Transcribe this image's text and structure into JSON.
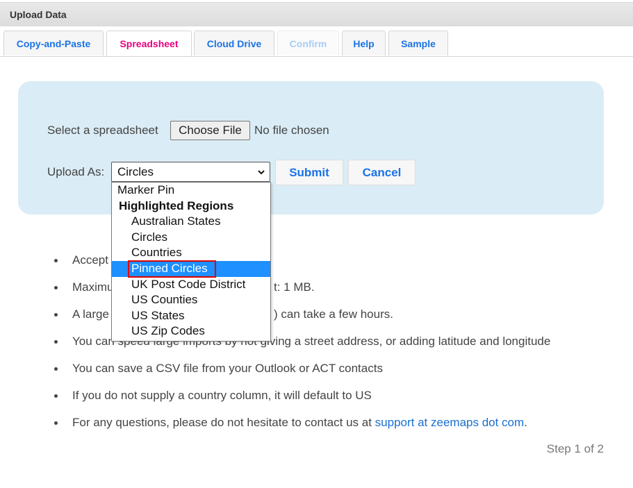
{
  "window": {
    "title": "Upload Data"
  },
  "tabs": [
    {
      "label": "Copy-and-Paste",
      "state": "normal"
    },
    {
      "label": "Spreadsheet",
      "state": "active"
    },
    {
      "label": "Cloud Drive",
      "state": "normal"
    },
    {
      "label": "Confirm",
      "state": "disabled"
    },
    {
      "label": "Help",
      "state": "normal"
    },
    {
      "label": "Sample",
      "state": "normal"
    }
  ],
  "form": {
    "file_label": "Select a spreadsheet",
    "file_button": "Choose File",
    "file_status": "No file chosen",
    "upload_as_label": "Upload As:",
    "upload_as_value": "Circles",
    "submit_label": "Submit",
    "cancel_label": "Cancel"
  },
  "dropdown": {
    "options": [
      {
        "label": "Marker Pin",
        "type": "option"
      },
      {
        "label": "Highlighted Regions",
        "type": "group"
      },
      {
        "label": "Australian States",
        "type": "indent"
      },
      {
        "label": "Circles",
        "type": "indent"
      },
      {
        "label": "Countries",
        "type": "indent"
      },
      {
        "label": "Pinned Circles",
        "type": "indent",
        "highlighted": true
      },
      {
        "label": "UK Post Code District",
        "type": "indent"
      },
      {
        "label": "US Counties",
        "type": "indent"
      },
      {
        "label": "US States",
        "type": "indent"
      },
      {
        "label": "US Zip Codes",
        "type": "indent"
      }
    ]
  },
  "notes": {
    "items": [
      {
        "text": "Accept"
      },
      {
        "text": "Maximu",
        "tail": "t: 1 MB."
      },
      {
        "text": "A large",
        "tail": ") can take a few hours."
      },
      {
        "text": "You can speed large imports by not giving a street address, or adding latitude and longitude"
      },
      {
        "text": "You can save a CSV file from your Outlook or ACT contacts"
      },
      {
        "text": "If you do not supply a country column, it will default to US"
      },
      {
        "text": "For any questions, please do not hesitate to contact us at ",
        "link": "support at zeemaps dot com",
        "suffix": "."
      }
    ]
  },
  "footer": {
    "step": "Step 1 of 2"
  },
  "colors": {
    "accent": "#1a73e8",
    "active_tab": "#e6007e",
    "panel_bg": "#daecf5",
    "highlight": "#1e90ff",
    "annotation_box": "#e00000"
  }
}
